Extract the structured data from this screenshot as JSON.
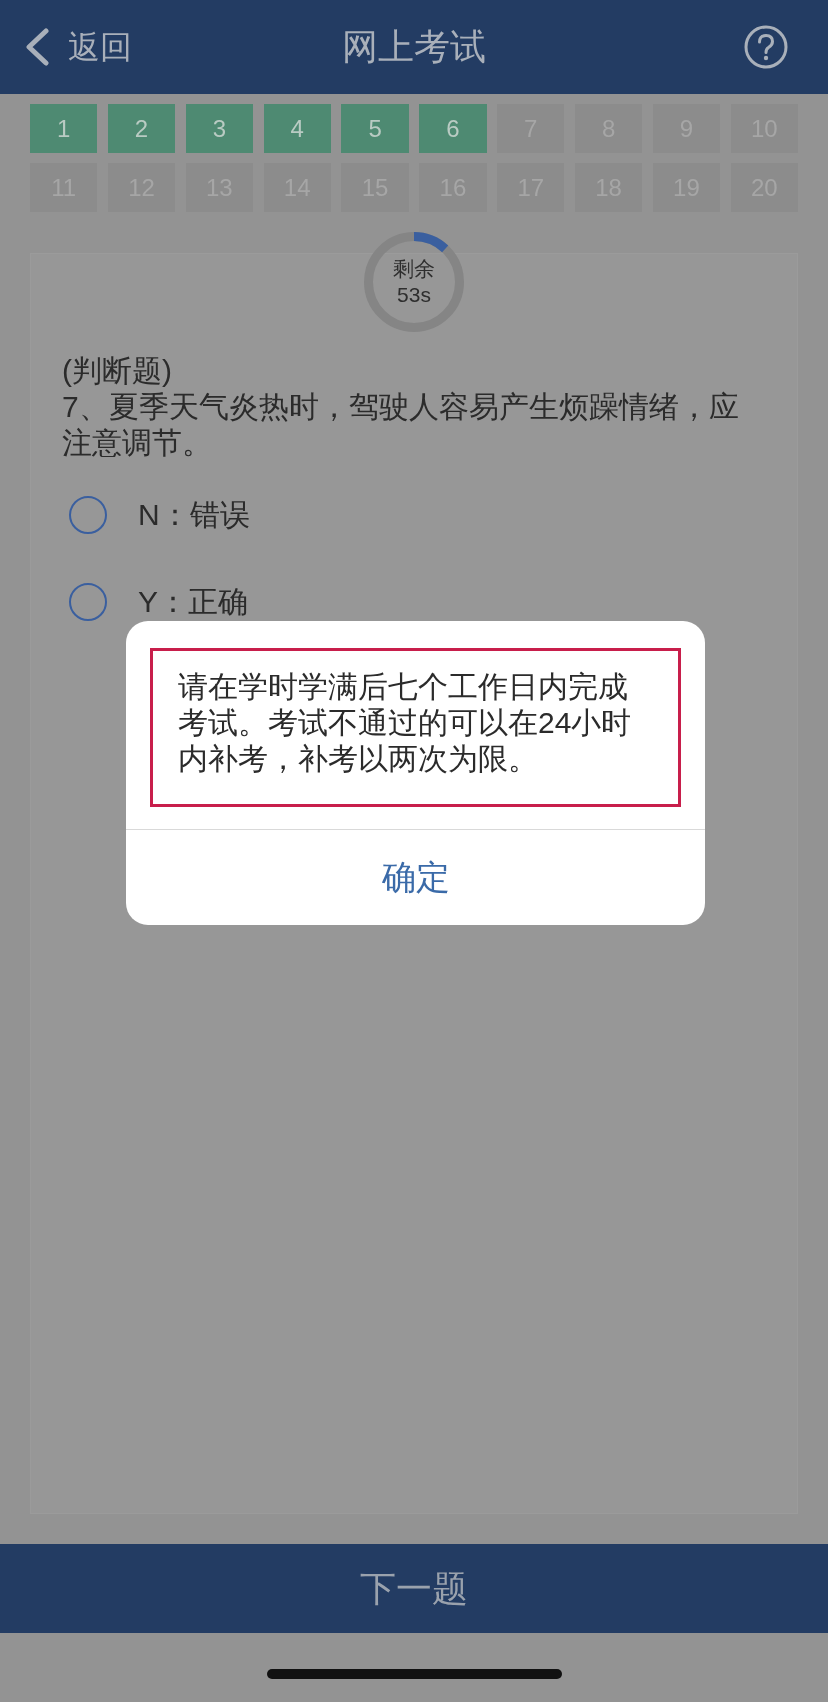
{
  "header": {
    "back_label": "返回",
    "title": "网上考试"
  },
  "question_grid": [
    {
      "label": "1",
      "answered": true
    },
    {
      "label": "2",
      "answered": true
    },
    {
      "label": "3",
      "answered": true
    },
    {
      "label": "4",
      "answered": true
    },
    {
      "label": "5",
      "answered": true
    },
    {
      "label": "6",
      "answered": true
    },
    {
      "label": "7",
      "answered": false
    },
    {
      "label": "8",
      "answered": false
    },
    {
      "label": "9",
      "answered": false
    },
    {
      "label": "10",
      "answered": false
    },
    {
      "label": "11",
      "answered": false
    },
    {
      "label": "12",
      "answered": false
    },
    {
      "label": "13",
      "answered": false
    },
    {
      "label": "14",
      "answered": false
    },
    {
      "label": "15",
      "answered": false
    },
    {
      "label": "16",
      "answered": false
    },
    {
      "label": "17",
      "answered": false
    },
    {
      "label": "18",
      "answered": false
    },
    {
      "label": "19",
      "answered": false
    },
    {
      "label": "20",
      "answered": false
    }
  ],
  "timer": {
    "label": "剩余",
    "reading": "53s",
    "level": 0.12
  },
  "question": {
    "type_label": "(判断题)",
    "text": "7、夏季天气炎热时，驾驶人容易产生烦躁情绪，应注意调节。",
    "options": [
      {
        "label": "N：错误",
        "selected": false
      },
      {
        "label": "Y：正确",
        "selected": false
      }
    ]
  },
  "dialog": {
    "message": "请在学时学满后七个工作日内完成考试。考试不通过的可以在24小时内补考，补考以两次为限。",
    "button": "确定"
  },
  "next_button": "下一题"
}
